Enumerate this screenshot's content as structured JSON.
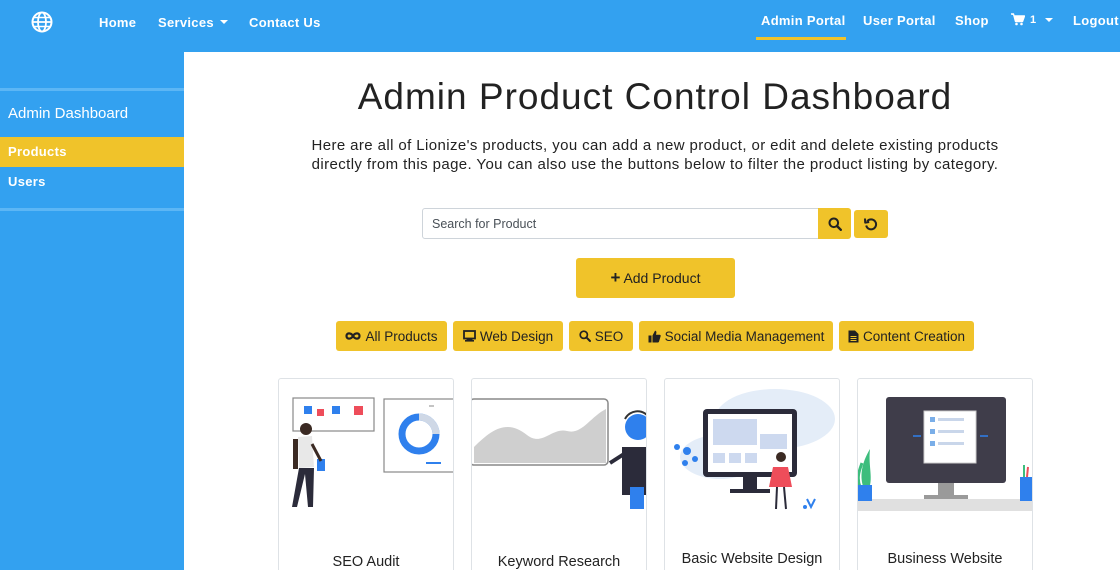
{
  "nav": {
    "brand_icon": "globe-icon",
    "home": "Home",
    "services": "Services",
    "contact": "Contact Us",
    "admin_portal": "Admin Portal",
    "user_portal": "User Portal",
    "shop": "Shop",
    "cart_count": "1",
    "cart_icon": "cart-icon",
    "logout": "Logout"
  },
  "sidebar": {
    "title": "Admin Dashboard",
    "items": [
      {
        "label": "Products",
        "active": true
      },
      {
        "label": "Users",
        "active": false
      }
    ]
  },
  "main": {
    "title": "Admin Product Control Dashboard",
    "intro": "Here are all of Lionize's products, you can add a new product, or edit and delete existing products directly from this page. You can also use the buttons below to filter the product listing by category.",
    "search_placeholder": "Search for Product",
    "add_button": "Add Product",
    "filters": [
      {
        "label": "All Products",
        "icon": "infinity-icon"
      },
      {
        "label": "Web Design",
        "icon": "monitor-icon"
      },
      {
        "label": "SEO",
        "icon": "magnifier-icon"
      },
      {
        "label": "Social Media Management",
        "icon": "thumbs-up-icon"
      },
      {
        "label": "Content Creation",
        "icon": "document-icon"
      }
    ]
  },
  "products": [
    {
      "title": "SEO Audit"
    },
    {
      "title": "Keyword Research"
    },
    {
      "title": "Basic Website Design"
    },
    {
      "title": "Business Website"
    }
  ],
  "colors": {
    "primary": "#33a1f0",
    "accent": "#f0c32a",
    "text": "#222222"
  }
}
